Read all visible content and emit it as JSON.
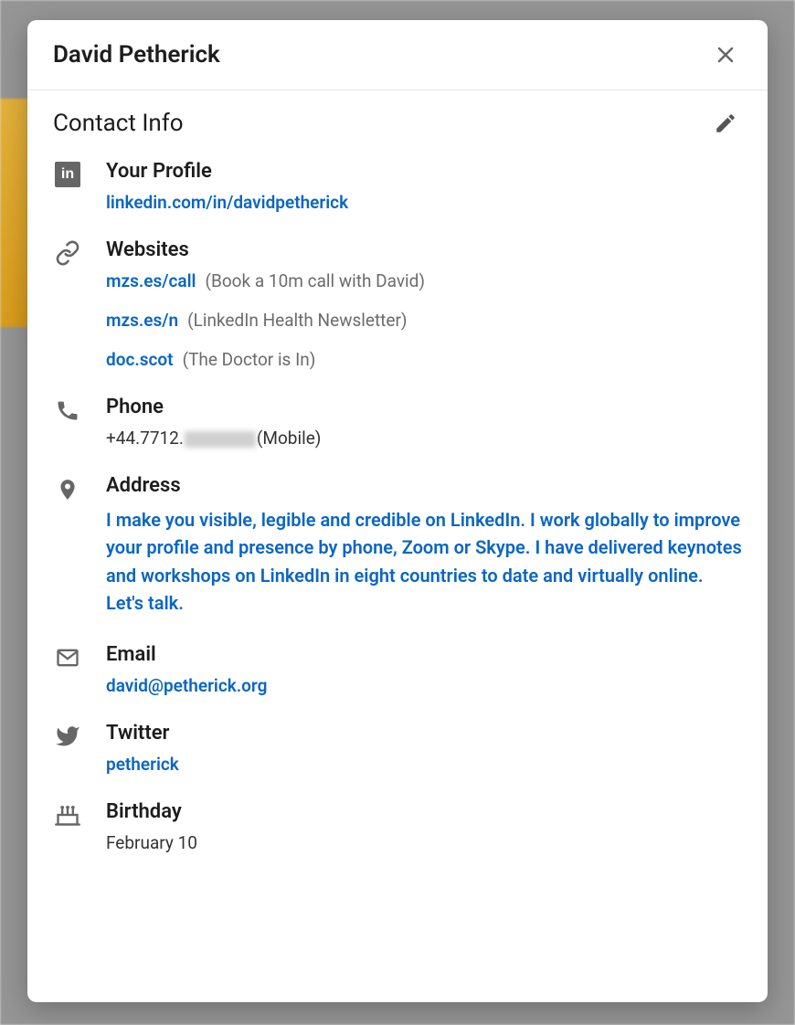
{
  "modal": {
    "title": "David Petherick",
    "section_title": "Contact Info",
    "profile": {
      "label": "Your Profile",
      "url": "linkedin.com/in/davidpetherick"
    },
    "websites": {
      "label": "Websites",
      "items": [
        {
          "url": "mzs.es/call",
          "desc": "(Book a 10m call with David)"
        },
        {
          "url": "mzs.es/n",
          "desc": "(LinkedIn Health Newsletter)"
        },
        {
          "url": "doc.scot",
          "desc": "(The Doctor is In)"
        }
      ]
    },
    "phone": {
      "label": "Phone",
      "prefix": "+44.7712.",
      "suffix": "(Mobile)"
    },
    "address": {
      "label": "Address",
      "text": "I make you visible, legible and credible on LinkedIn. I work globally to improve your profile and presence by phone, Zoom or Skype. I have delivered keynotes and workshops on LinkedIn in eight countries to date and virtually online. Let's talk."
    },
    "email": {
      "label": "Email",
      "value": "david@petherick.org"
    },
    "twitter": {
      "label": "Twitter",
      "value": "petherick"
    },
    "birthday": {
      "label": "Birthday",
      "value": "February 10"
    }
  }
}
